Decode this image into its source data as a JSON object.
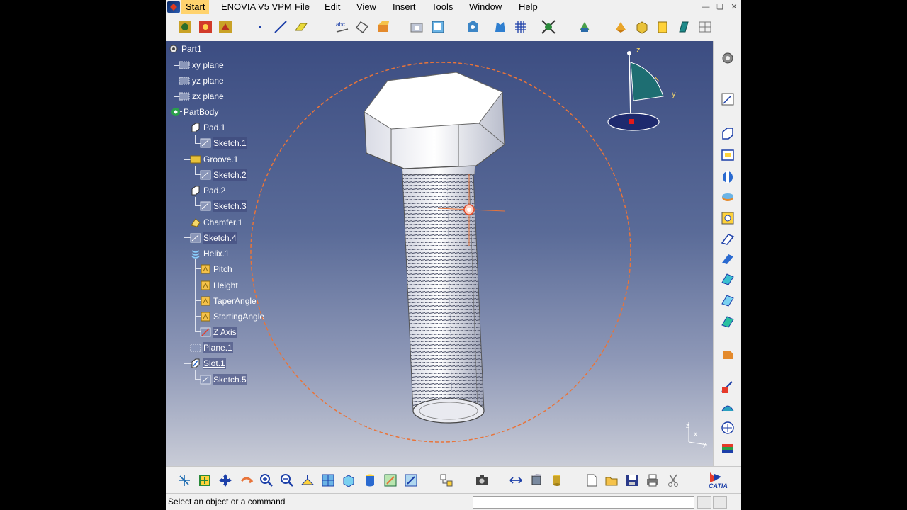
{
  "menu": {
    "items": [
      "Start",
      "ENOVIA V5 VPM",
      "File",
      "Edit",
      "View",
      "Insert",
      "Tools",
      "Window",
      "Help"
    ]
  },
  "tree": {
    "root": "Part1",
    "nodes": [
      {
        "label": "xy plane",
        "icon": "plane-icon"
      },
      {
        "label": "yz plane",
        "icon": "plane-icon"
      },
      {
        "label": "zx plane",
        "icon": "plane-icon"
      },
      {
        "label": "PartBody",
        "icon": "body-gear-icon"
      },
      {
        "label": "Pad.1",
        "icon": "pad-icon"
      },
      {
        "label": "Sketch.1",
        "icon": "sketch-icon"
      },
      {
        "label": "Groove.1",
        "icon": "groove-icon"
      },
      {
        "label": "Sketch.2",
        "icon": "sketch-icon"
      },
      {
        "label": "Pad.2",
        "icon": "pad-icon"
      },
      {
        "label": "Sketch.3",
        "icon": "sketch-icon"
      },
      {
        "label": "Chamfer.1",
        "icon": "chamfer-icon"
      },
      {
        "label": "Sketch.4",
        "icon": "sketch-icon"
      },
      {
        "label": "Helix.1",
        "icon": "helix-icon"
      },
      {
        "label": "Pitch",
        "icon": "parameter-icon"
      },
      {
        "label": "Height",
        "icon": "parameter-icon"
      },
      {
        "label": "TaperAngle",
        "icon": "parameter-icon"
      },
      {
        "label": "StartingAngle",
        "icon": "parameter-icon"
      },
      {
        "label": "Z Axis",
        "icon": "axis-icon"
      },
      {
        "label": "Plane.1",
        "icon": "plane-icon"
      },
      {
        "label": "Slot.1",
        "icon": "slot-icon"
      },
      {
        "label": "Sketch.5",
        "icon": "sketch-icon"
      }
    ]
  },
  "compass": {
    "z_label": "z",
    "y_label": "y"
  },
  "axis_triad": {
    "x_label": "x",
    "y_label": "y",
    "z_label": "z"
  },
  "status": {
    "text": "Select an object or a command",
    "input_value": ""
  },
  "brand": {
    "logo_text": "CATIA"
  },
  "colors": {
    "viewport_top": "#3c4d82",
    "viewport_bottom": "#c9ccd7",
    "menu_active": "#ffd36e",
    "selection_circle": "#e8743a"
  }
}
